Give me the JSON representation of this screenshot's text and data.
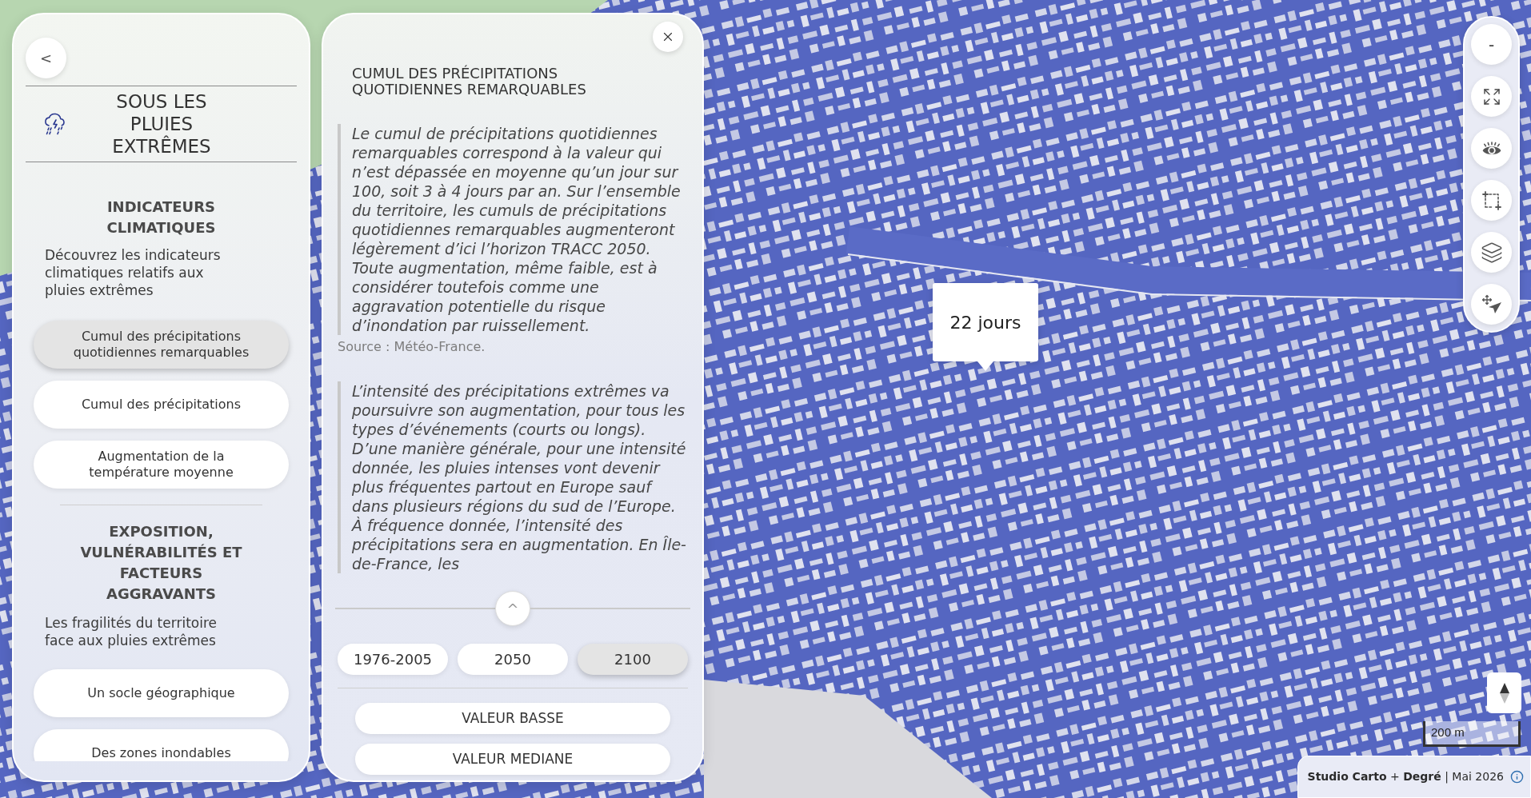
{
  "left_panel": {
    "back_label": "<",
    "title": "SOUS LES PLUIES EXTRÊMES",
    "sections": [
      {
        "heading": "INDICATEURS CLIMATIQUES",
        "description": "Découvrez les indicateurs climatiques relatifs aux pluies extrêmes",
        "items": [
          {
            "label": "Cumul des précipitations quotidiennes remarquables",
            "selected": true
          },
          {
            "label": "Cumul des précipitations",
            "selected": false
          },
          {
            "label": "Augmentation de la température moyenne",
            "selected": false
          }
        ]
      },
      {
        "heading": "EXPOSITION, VULNÉRABILITÉS ET FACTEURS AGGRAVANTS",
        "description": "Les fragilités du territoire face aux pluies extrêmes",
        "items": [
          {
            "label": "Un socle géographique",
            "selected": false
          },
          {
            "label": "Des zones inondables",
            "selected": false
          }
        ]
      }
    ]
  },
  "detail_panel": {
    "title": "CUMUL DES PRÉCIPITATIONS QUOTIDIENNES REMARQUABLES",
    "quotes": [
      {
        "text": "Le cumul de précipitations quotidiennes remarquables correspond à la valeur qui n’est dépassée en moyenne qu’un jour sur 100, soit 3 à 4 jours par an. Sur l’ensemble du territoire, les cumuls de précipitations quotidiennes remarquables augmenteront légèrement d’ici l’horizon TRACC 2050. Toute augmentation, même faible, est à considérer toutefois comme une aggravation potentielle du risque d’inondation par ruissellement.",
        "source": "Source : Météo-France."
      },
      {
        "text": "L’intensité des précipitations extrêmes va poursuivre son augmentation, pour tous les types d’événements (courts ou longs). D’une manière générale, pour une intensité donnée, les pluies intenses vont devenir plus fréquentes partout en Europe sauf dans plusieurs régions du sud de l’Europe. À fréquence donnée, l’intensité des précipitations sera en augmentation. En Île-de-France, les"
      }
    ],
    "collapse_label": "^",
    "periods": [
      {
        "label": "1976-2005",
        "selected": false
      },
      {
        "label": "2050",
        "selected": false
      },
      {
        "label": "2100",
        "selected": true
      }
    ],
    "values": [
      {
        "label": "VALEUR BASSE",
        "selected": false
      },
      {
        "label": "VALEUR MEDIANE",
        "selected": false
      }
    ]
  },
  "map": {
    "popup": "22 jours",
    "scale": "200 m",
    "attribution": "**Studio Carto** + **Degré** | Mai 2026"
  },
  "toolbar": {
    "zoom_out_label": "-"
  }
}
